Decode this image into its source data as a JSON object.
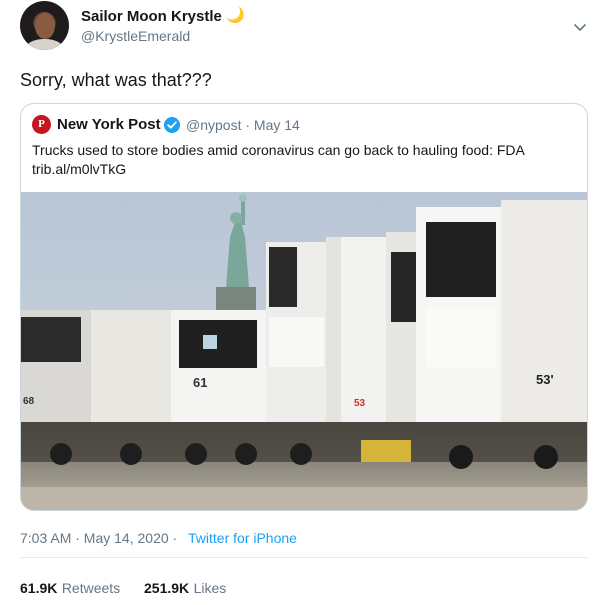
{
  "author": {
    "name": "Sailor Moon Krystle",
    "emoji": "🌙",
    "handle": "@KrystleEmerald"
  },
  "tweet_text": "Sorry, what was that???",
  "quoted_tweet": {
    "source_name": "New York Post",
    "logo_letter": "P",
    "handle_date": "@nypost · May 14",
    "text": "Trucks used to store bodies amid coronavirus can go back to hauling food: FDA",
    "link": "trib.al/m0lvTkG",
    "image": {
      "truck_labels": [
        "61",
        "68",
        "53'",
        "53"
      ]
    }
  },
  "timestamp": "7:03 AM · May 14, 2020 · ",
  "source": "Twitter for iPhone",
  "stats": {
    "retweets_count": "61.9K",
    "retweets_label": "Retweets",
    "likes_count": "251.9K",
    "likes_label": "Likes"
  },
  "colors": {
    "link": "#1da1f2",
    "secondary_text": "#657786",
    "border": "#ccd6dd",
    "nypost_red": "#c4161c"
  },
  "icons": {
    "menu": "chevron-down-icon",
    "verified": "verified-badge-icon"
  }
}
